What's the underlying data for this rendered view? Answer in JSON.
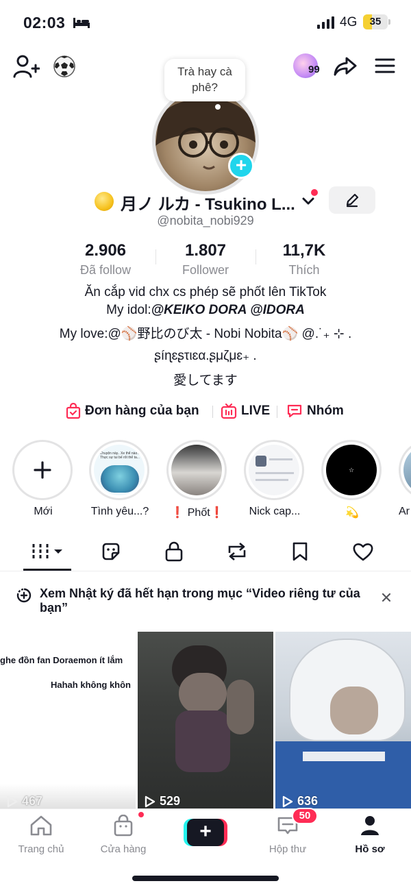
{
  "status_bar": {
    "time": "02:03",
    "network": "4G",
    "battery": "35",
    "battery_level": 0.35,
    "sleep_icon": "bed-icon"
  },
  "top_nav": {
    "friends_count": "99",
    "icons": [
      "add-friend-icon",
      "soccer-ball-icon",
      "share-icon",
      "menu-icon"
    ]
  },
  "profile": {
    "bubble_text": "Trà hay cà phê?",
    "display_name": "月ノ ルカ - Tsukino L...",
    "username": "@nobita_nobi929",
    "stats": [
      {
        "value": "2.906",
        "label": "Đã follow"
      },
      {
        "value": "1.807",
        "label": "Follower"
      },
      {
        "value": "11,7K",
        "label": "Thích"
      }
    ],
    "bio": {
      "line1": "Ăn cắp vid chx cs phép sẽ phốt lên TikTok",
      "line2_prefix": "My idol:",
      "line2_strong": "@KEIKO DORA @IDORA",
      "line3": "My love:@⚾野比のび太 - Nobi Nobita⚾ @.˙₊ ⊹ .",
      "line4": "ʂíɳɛʂτιɛα.ʂμζμɛ₊ .",
      "line5": "愛してます"
    }
  },
  "links": [
    {
      "label": "Đơn hàng của bạn",
      "icon": "shopping-bag-icon"
    },
    {
      "label": "LIVE",
      "icon": "live-tv-icon"
    },
    {
      "label": "Nhóm",
      "icon": "chat-group-icon"
    }
  ],
  "highlights": [
    {
      "label": "Mới"
    },
    {
      "label": "Tình yêu...?"
    },
    {
      "label": "❗ Phốt❗"
    },
    {
      "label": "Nick cap..."
    },
    {
      "label": "💫"
    },
    {
      "label": "Ar"
    }
  ],
  "highlight_texts": {
    "h1_caption": "Chuyện này.. Xe thể nào... Thực sự tui bế rốt thể ta..."
  },
  "tabs": [
    "grid-videos-icon",
    "reposts-sticker-icon",
    "private-lock-icon",
    "repost-icon",
    "favorites-bookmark-icon",
    "liked-heart-icon"
  ],
  "notice": {
    "text": "Xem Nhật ký đã hết hạn trong mục “Video riêng tư của bạn”"
  },
  "videos": [
    {
      "views": "467",
      "caption1": "ghe đồn fan Doraemon ít lắm",
      "caption2": "Hahah không khôn"
    },
    {
      "views": "529"
    },
    {
      "views": "636"
    }
  ],
  "bottom_nav": {
    "items": [
      {
        "label": "Trang chủ"
      },
      {
        "label": "Cửa hàng"
      },
      {
        "label": "Hộp thư"
      },
      {
        "label": "Hồ sơ"
      }
    ],
    "inbox_badge": "50"
  },
  "colors": {
    "accent_red": "#fe2c55",
    "accent_cyan": "#25f4ee",
    "text_primary": "#161823",
    "text_secondary": "#8a8b91"
  }
}
